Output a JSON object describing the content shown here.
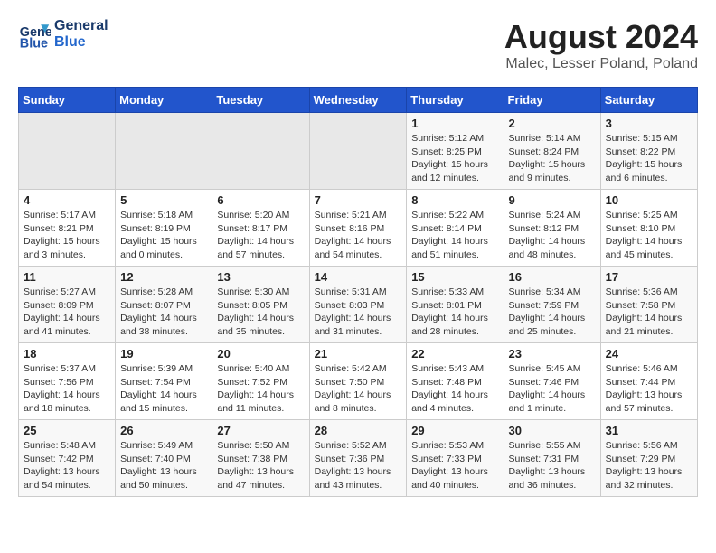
{
  "header": {
    "logo_line1": "General",
    "logo_line2": "Blue",
    "month_year": "August 2024",
    "location": "Malec, Lesser Poland, Poland"
  },
  "days_of_week": [
    "Sunday",
    "Monday",
    "Tuesday",
    "Wednesday",
    "Thursday",
    "Friday",
    "Saturday"
  ],
  "weeks": [
    [
      {
        "day": "",
        "info": ""
      },
      {
        "day": "",
        "info": ""
      },
      {
        "day": "",
        "info": ""
      },
      {
        "day": "",
        "info": ""
      },
      {
        "day": "1",
        "info": "Sunrise: 5:12 AM\nSunset: 8:25 PM\nDaylight: 15 hours\nand 12 minutes."
      },
      {
        "day": "2",
        "info": "Sunrise: 5:14 AM\nSunset: 8:24 PM\nDaylight: 15 hours\nand 9 minutes."
      },
      {
        "day": "3",
        "info": "Sunrise: 5:15 AM\nSunset: 8:22 PM\nDaylight: 15 hours\nand 6 minutes."
      }
    ],
    [
      {
        "day": "4",
        "info": "Sunrise: 5:17 AM\nSunset: 8:21 PM\nDaylight: 15 hours\nand 3 minutes."
      },
      {
        "day": "5",
        "info": "Sunrise: 5:18 AM\nSunset: 8:19 PM\nDaylight: 15 hours\nand 0 minutes."
      },
      {
        "day": "6",
        "info": "Sunrise: 5:20 AM\nSunset: 8:17 PM\nDaylight: 14 hours\nand 57 minutes."
      },
      {
        "day": "7",
        "info": "Sunrise: 5:21 AM\nSunset: 8:16 PM\nDaylight: 14 hours\nand 54 minutes."
      },
      {
        "day": "8",
        "info": "Sunrise: 5:22 AM\nSunset: 8:14 PM\nDaylight: 14 hours\nand 51 minutes."
      },
      {
        "day": "9",
        "info": "Sunrise: 5:24 AM\nSunset: 8:12 PM\nDaylight: 14 hours\nand 48 minutes."
      },
      {
        "day": "10",
        "info": "Sunrise: 5:25 AM\nSunset: 8:10 PM\nDaylight: 14 hours\nand 45 minutes."
      }
    ],
    [
      {
        "day": "11",
        "info": "Sunrise: 5:27 AM\nSunset: 8:09 PM\nDaylight: 14 hours\nand 41 minutes."
      },
      {
        "day": "12",
        "info": "Sunrise: 5:28 AM\nSunset: 8:07 PM\nDaylight: 14 hours\nand 38 minutes."
      },
      {
        "day": "13",
        "info": "Sunrise: 5:30 AM\nSunset: 8:05 PM\nDaylight: 14 hours\nand 35 minutes."
      },
      {
        "day": "14",
        "info": "Sunrise: 5:31 AM\nSunset: 8:03 PM\nDaylight: 14 hours\nand 31 minutes."
      },
      {
        "day": "15",
        "info": "Sunrise: 5:33 AM\nSunset: 8:01 PM\nDaylight: 14 hours\nand 28 minutes."
      },
      {
        "day": "16",
        "info": "Sunrise: 5:34 AM\nSunset: 7:59 PM\nDaylight: 14 hours\nand 25 minutes."
      },
      {
        "day": "17",
        "info": "Sunrise: 5:36 AM\nSunset: 7:58 PM\nDaylight: 14 hours\nand 21 minutes."
      }
    ],
    [
      {
        "day": "18",
        "info": "Sunrise: 5:37 AM\nSunset: 7:56 PM\nDaylight: 14 hours\nand 18 minutes."
      },
      {
        "day": "19",
        "info": "Sunrise: 5:39 AM\nSunset: 7:54 PM\nDaylight: 14 hours\nand 15 minutes."
      },
      {
        "day": "20",
        "info": "Sunrise: 5:40 AM\nSunset: 7:52 PM\nDaylight: 14 hours\nand 11 minutes."
      },
      {
        "day": "21",
        "info": "Sunrise: 5:42 AM\nSunset: 7:50 PM\nDaylight: 14 hours\nand 8 minutes."
      },
      {
        "day": "22",
        "info": "Sunrise: 5:43 AM\nSunset: 7:48 PM\nDaylight: 14 hours\nand 4 minutes."
      },
      {
        "day": "23",
        "info": "Sunrise: 5:45 AM\nSunset: 7:46 PM\nDaylight: 14 hours\nand 1 minute."
      },
      {
        "day": "24",
        "info": "Sunrise: 5:46 AM\nSunset: 7:44 PM\nDaylight: 13 hours\nand 57 minutes."
      }
    ],
    [
      {
        "day": "25",
        "info": "Sunrise: 5:48 AM\nSunset: 7:42 PM\nDaylight: 13 hours\nand 54 minutes."
      },
      {
        "day": "26",
        "info": "Sunrise: 5:49 AM\nSunset: 7:40 PM\nDaylight: 13 hours\nand 50 minutes."
      },
      {
        "day": "27",
        "info": "Sunrise: 5:50 AM\nSunset: 7:38 PM\nDaylight: 13 hours\nand 47 minutes."
      },
      {
        "day": "28",
        "info": "Sunrise: 5:52 AM\nSunset: 7:36 PM\nDaylight: 13 hours\nand 43 minutes."
      },
      {
        "day": "29",
        "info": "Sunrise: 5:53 AM\nSunset: 7:33 PM\nDaylight: 13 hours\nand 40 minutes."
      },
      {
        "day": "30",
        "info": "Sunrise: 5:55 AM\nSunset: 7:31 PM\nDaylight: 13 hours\nand 36 minutes."
      },
      {
        "day": "31",
        "info": "Sunrise: 5:56 AM\nSunset: 7:29 PM\nDaylight: 13 hours\nand 32 minutes."
      }
    ]
  ]
}
